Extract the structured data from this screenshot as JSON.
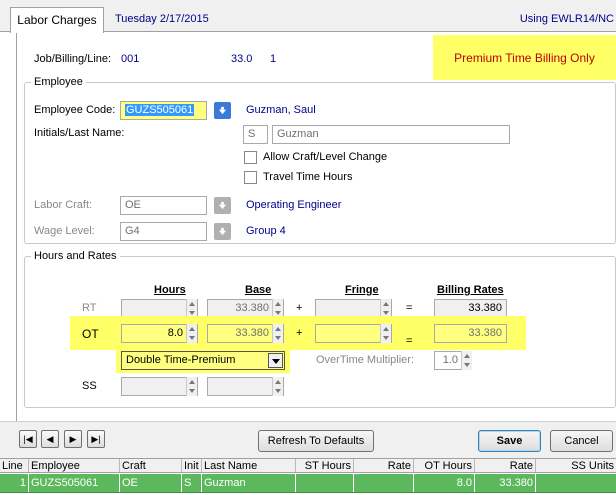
{
  "header": {
    "tab_label": "Labor Charges",
    "date": "Tuesday  2/17/2015",
    "using": "Using EWLR14/NC"
  },
  "job": {
    "label": "Job/Billing/Line:",
    "job": "001",
    "billing": "33.0",
    "line": "1",
    "premium_notice": "Premium Time Billing Only"
  },
  "employee": {
    "group_title": "Employee",
    "code_label": "Employee Code:",
    "code_value": "GUZS505061",
    "name_display": "Guzman, Saul",
    "initials_label": "Initials/Last Name:",
    "initials_value": "S",
    "last_name_value": "Guzman",
    "allow_craft_label": "Allow Craft/Level Change",
    "allow_craft_checked": false,
    "travel_time_label": "Travel Time Hours",
    "travel_time_checked": false,
    "craft_label": "Labor Craft:",
    "craft_value": "OE",
    "craft_desc": "Operating Engineer",
    "wage_label": "Wage Level:",
    "wage_value": "G4",
    "wage_desc": "Group 4"
  },
  "rates": {
    "group_title": "Hours and Rates",
    "col_hours": "Hours",
    "col_base": "Base",
    "col_fringe": "Fringe",
    "col_billing": "Billing Rates",
    "op_plus": "+",
    "op_equals": "=",
    "rt_label": "RT",
    "rt_hours": "",
    "rt_base": "33.380",
    "rt_fringe": "",
    "rt_billing": "33.380",
    "ot_label": "OT",
    "ot_hours": "8.0",
    "ot_base": "33.380",
    "ot_fringe": "",
    "ot_billing": "33.380",
    "ot_type": "Double Time-Premium",
    "ot_multiplier_label": "OverTime Multiplier:",
    "ot_multiplier": "1.0",
    "ss_label": "SS",
    "ss_hours": "",
    "ss_base": ""
  },
  "bottom": {
    "nav_first": "|◀",
    "nav_prev": "◀",
    "nav_next": "▶",
    "nav_last": "▶|",
    "refresh_label": "Refresh To Defaults",
    "save_label": "Save",
    "cancel_label": "Cancel"
  },
  "grid": {
    "headers": [
      "Line",
      "Employee",
      "Craft",
      "Init",
      "Last Name",
      "ST Hours",
      "Rate",
      "OT Hours",
      "Rate",
      "SS Units"
    ],
    "rows": [
      [
        "1",
        "GUZS505061",
        "OE",
        "S",
        "Guzman",
        "",
        "",
        "8.0",
        "33.380",
        ""
      ]
    ]
  },
  "colors": {
    "highlight_yellow": "#ffff66",
    "premium_text": "#c00000",
    "selected_row": "#5cb85c",
    "link_blue": "#00008b"
  }
}
